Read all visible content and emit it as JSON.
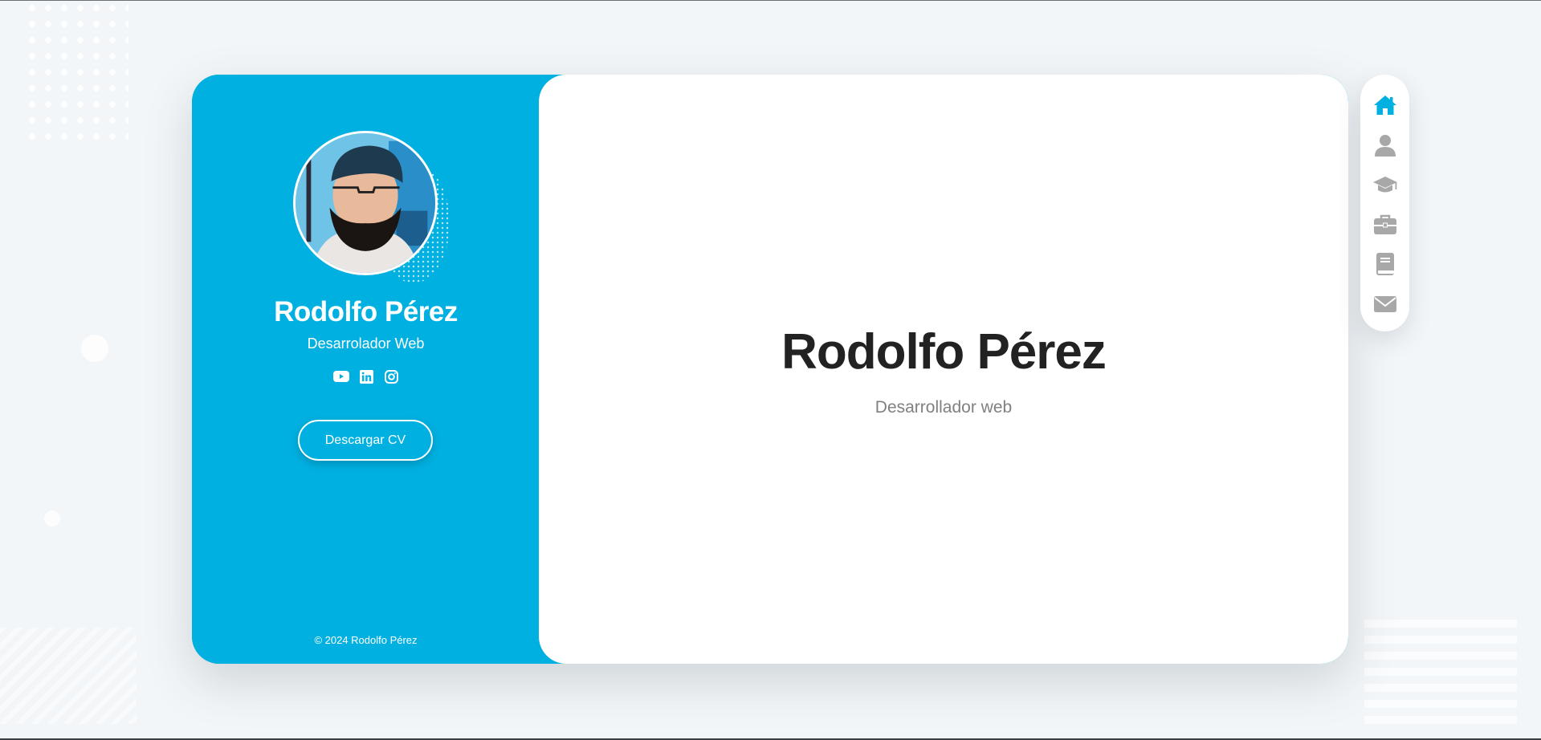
{
  "profile": {
    "name": "Rodolfo Pérez",
    "role": "Desarrolador Web",
    "cv_button": "Descargar CV",
    "copyright": "© 2024 Rodolfo Pérez",
    "socials": [
      "youtube-icon",
      "linkedin-icon",
      "instagram-icon"
    ]
  },
  "main": {
    "title": "Rodolfo Pérez",
    "subtitle": "Desarrollador web"
  },
  "nav": {
    "items": [
      "home-icon",
      "user-icon",
      "graduation-cap-icon",
      "briefcase-icon",
      "book-icon",
      "envelope-icon"
    ],
    "active": "home-icon"
  },
  "colors": {
    "accent": "#00b0e0",
    "nav_inactive": "#a8a8a8",
    "background": "#f3f6f8"
  }
}
